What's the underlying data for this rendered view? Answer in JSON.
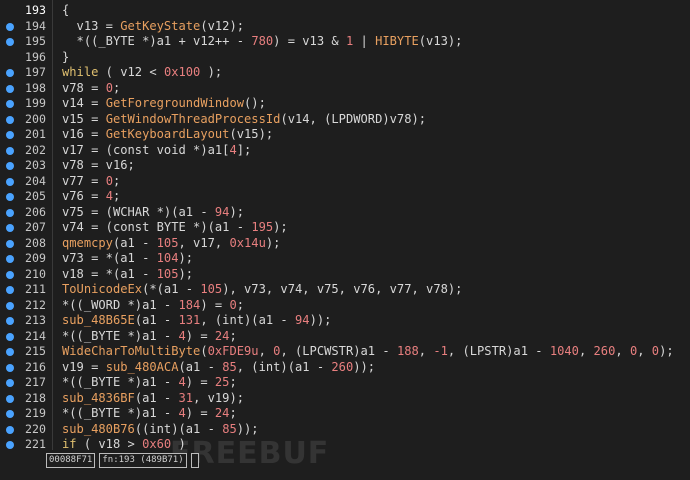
{
  "lines": [
    {
      "number": "193",
      "breakpoint": false,
      "current": true,
      "segments": [
        {
          "t": "{",
          "c": "plain"
        }
      ]
    },
    {
      "number": "194",
      "breakpoint": true,
      "segments": [
        {
          "t": "  v13 = ",
          "c": "plain"
        },
        {
          "t": "GetKeyState",
          "c": "fn"
        },
        {
          "t": "(v12);",
          "c": "plain"
        }
      ]
    },
    {
      "number": "195",
      "breakpoint": true,
      "segments": [
        {
          "t": "  *((_BYTE *)a1 + v12++ - ",
          "c": "plain"
        },
        {
          "t": "780",
          "c": "num"
        },
        {
          "t": ") = v13 & ",
          "c": "plain"
        },
        {
          "t": "1",
          "c": "num"
        },
        {
          "t": " | ",
          "c": "plain"
        },
        {
          "t": "HIBYTE",
          "c": "fn"
        },
        {
          "t": "(v13);",
          "c": "plain"
        }
      ]
    },
    {
      "number": "196",
      "breakpoint": false,
      "segments": [
        {
          "t": "}",
          "c": "plain"
        }
      ]
    },
    {
      "number": "197",
      "breakpoint": true,
      "segments": [
        {
          "t": "while",
          "c": "kw"
        },
        {
          "t": " ( v12 < ",
          "c": "plain"
        },
        {
          "t": "0x100",
          "c": "num"
        },
        {
          "t": " );",
          "c": "plain"
        }
      ]
    },
    {
      "number": "198",
      "breakpoint": true,
      "segments": [
        {
          "t": "v78 = ",
          "c": "plain"
        },
        {
          "t": "0",
          "c": "num"
        },
        {
          "t": ";",
          "c": "plain"
        }
      ]
    },
    {
      "number": "199",
      "breakpoint": true,
      "segments": [
        {
          "t": "v14 = ",
          "c": "plain"
        },
        {
          "t": "GetForegroundWindow",
          "c": "fn"
        },
        {
          "t": "();",
          "c": "plain"
        }
      ]
    },
    {
      "number": "200",
      "breakpoint": true,
      "segments": [
        {
          "t": "v15 = ",
          "c": "plain"
        },
        {
          "t": "GetWindowThreadProcessId",
          "c": "fn"
        },
        {
          "t": "(v14, (LPDWORD)v78);",
          "c": "plain"
        }
      ]
    },
    {
      "number": "201",
      "breakpoint": true,
      "segments": [
        {
          "t": "v16 = ",
          "c": "plain"
        },
        {
          "t": "GetKeyboardLayout",
          "c": "fn"
        },
        {
          "t": "(v15);",
          "c": "plain"
        }
      ]
    },
    {
      "number": "202",
      "breakpoint": true,
      "segments": [
        {
          "t": "v17 = (const void *)a1[",
          "c": "plain"
        },
        {
          "t": "4",
          "c": "num"
        },
        {
          "t": "];",
          "c": "plain"
        }
      ]
    },
    {
      "number": "203",
      "breakpoint": true,
      "segments": [
        {
          "t": "v78 = v16;",
          "c": "plain"
        }
      ]
    },
    {
      "number": "204",
      "breakpoint": true,
      "segments": [
        {
          "t": "v77 = ",
          "c": "plain"
        },
        {
          "t": "0",
          "c": "num"
        },
        {
          "t": ";",
          "c": "plain"
        }
      ]
    },
    {
      "number": "205",
      "breakpoint": true,
      "segments": [
        {
          "t": "v76 = ",
          "c": "plain"
        },
        {
          "t": "4",
          "c": "num"
        },
        {
          "t": ";",
          "c": "plain"
        }
      ]
    },
    {
      "number": "206",
      "breakpoint": true,
      "segments": [
        {
          "t": "v75 = (WCHAR *)(a1 - ",
          "c": "plain"
        },
        {
          "t": "94",
          "c": "num"
        },
        {
          "t": ");",
          "c": "plain"
        }
      ]
    },
    {
      "number": "207",
      "breakpoint": true,
      "segments": [
        {
          "t": "v74 = (const BYTE *)(a1 - ",
          "c": "plain"
        },
        {
          "t": "195",
          "c": "num"
        },
        {
          "t": ");",
          "c": "plain"
        }
      ]
    },
    {
      "number": "208",
      "breakpoint": true,
      "segments": [
        {
          "t": "qmemcpy",
          "c": "fn"
        },
        {
          "t": "(a1 - ",
          "c": "plain"
        },
        {
          "t": "105",
          "c": "num"
        },
        {
          "t": ", v17, ",
          "c": "plain"
        },
        {
          "t": "0x14u",
          "c": "num"
        },
        {
          "t": ");",
          "c": "plain"
        }
      ]
    },
    {
      "number": "209",
      "breakpoint": true,
      "segments": [
        {
          "t": "v73 = *(a1 - ",
          "c": "plain"
        },
        {
          "t": "104",
          "c": "num"
        },
        {
          "t": ");",
          "c": "plain"
        }
      ]
    },
    {
      "number": "210",
      "breakpoint": true,
      "segments": [
        {
          "t": "v18 = *(a1 - ",
          "c": "plain"
        },
        {
          "t": "105",
          "c": "num"
        },
        {
          "t": ");",
          "c": "plain"
        }
      ]
    },
    {
      "number": "211",
      "breakpoint": true,
      "segments": [
        {
          "t": "ToUnicodeEx",
          "c": "fn"
        },
        {
          "t": "(*(a1 - ",
          "c": "plain"
        },
        {
          "t": "105",
          "c": "num"
        },
        {
          "t": "), v73, v74, v75, v76, v77, v78);",
          "c": "plain"
        }
      ]
    },
    {
      "number": "212",
      "breakpoint": true,
      "segments": [
        {
          "t": "*((_WORD *)a1 - ",
          "c": "plain"
        },
        {
          "t": "184",
          "c": "num"
        },
        {
          "t": ") = ",
          "c": "plain"
        },
        {
          "t": "0",
          "c": "num"
        },
        {
          "t": ";",
          "c": "plain"
        }
      ]
    },
    {
      "number": "213",
      "breakpoint": true,
      "segments": [
        {
          "t": "sub_48B65E",
          "c": "fn"
        },
        {
          "t": "(a1 - ",
          "c": "plain"
        },
        {
          "t": "131",
          "c": "num"
        },
        {
          "t": ", (int)(a1 - ",
          "c": "plain"
        },
        {
          "t": "94",
          "c": "num"
        },
        {
          "t": "));",
          "c": "plain"
        }
      ]
    },
    {
      "number": "214",
      "breakpoint": true,
      "segments": [
        {
          "t": "*((_BYTE *)a1 - ",
          "c": "plain"
        },
        {
          "t": "4",
          "c": "num"
        },
        {
          "t": ") = ",
          "c": "plain"
        },
        {
          "t": "24",
          "c": "num"
        },
        {
          "t": ";",
          "c": "plain"
        }
      ]
    },
    {
      "number": "215",
      "breakpoint": true,
      "segments": [
        {
          "t": "WideCharToMultiByte",
          "c": "fn"
        },
        {
          "t": "(",
          "c": "plain"
        },
        {
          "t": "0xFDE9u",
          "c": "num"
        },
        {
          "t": ", ",
          "c": "plain"
        },
        {
          "t": "0",
          "c": "num"
        },
        {
          "t": ", (LPCWSTR)a1 - ",
          "c": "plain"
        },
        {
          "t": "188",
          "c": "num"
        },
        {
          "t": ", ",
          "c": "plain"
        },
        {
          "t": "-1",
          "c": "num"
        },
        {
          "t": ", (LPSTR)a1 - ",
          "c": "plain"
        },
        {
          "t": "1040",
          "c": "num"
        },
        {
          "t": ", ",
          "c": "plain"
        },
        {
          "t": "260",
          "c": "num"
        },
        {
          "t": ", ",
          "c": "plain"
        },
        {
          "t": "0",
          "c": "num"
        },
        {
          "t": ", ",
          "c": "plain"
        },
        {
          "t": "0",
          "c": "num"
        },
        {
          "t": ");",
          "c": "plain"
        }
      ]
    },
    {
      "number": "216",
      "breakpoint": true,
      "segments": [
        {
          "t": "v19 = ",
          "c": "plain"
        },
        {
          "t": "sub_480ACA",
          "c": "fn"
        },
        {
          "t": "(a1 - ",
          "c": "plain"
        },
        {
          "t": "85",
          "c": "num"
        },
        {
          "t": ", (int)(a1 - ",
          "c": "plain"
        },
        {
          "t": "260",
          "c": "num"
        },
        {
          "t": "));",
          "c": "plain"
        }
      ]
    },
    {
      "number": "217",
      "breakpoint": true,
      "segments": [
        {
          "t": "*((_BYTE *)a1 - ",
          "c": "plain"
        },
        {
          "t": "4",
          "c": "num"
        },
        {
          "t": ") = ",
          "c": "plain"
        },
        {
          "t": "25",
          "c": "num"
        },
        {
          "t": ";",
          "c": "plain"
        }
      ]
    },
    {
      "number": "218",
      "breakpoint": true,
      "segments": [
        {
          "t": "sub_4836BF",
          "c": "fn"
        },
        {
          "t": "(a1 - ",
          "c": "plain"
        },
        {
          "t": "31",
          "c": "num"
        },
        {
          "t": ", v19);",
          "c": "plain"
        }
      ]
    },
    {
      "number": "219",
      "breakpoint": true,
      "segments": [
        {
          "t": "*((_BYTE *)a1 - ",
          "c": "plain"
        },
        {
          "t": "4",
          "c": "num"
        },
        {
          "t": ") = ",
          "c": "plain"
        },
        {
          "t": "24",
          "c": "num"
        },
        {
          "t": ";",
          "c": "plain"
        }
      ]
    },
    {
      "number": "220",
      "breakpoint": true,
      "segments": [
        {
          "t": "sub_480B76",
          "c": "fn"
        },
        {
          "t": "((int)(a1 - ",
          "c": "plain"
        },
        {
          "t": "85",
          "c": "num"
        },
        {
          "t": "));",
          "c": "plain"
        }
      ]
    },
    {
      "number": "221",
      "breakpoint": true,
      "segments": [
        {
          "t": "if",
          "c": "kw"
        },
        {
          "t": " ( v18 > ",
          "c": "plain"
        },
        {
          "t": "0x60",
          "c": "num"
        },
        {
          "t": " )",
          "c": "plain"
        }
      ]
    }
  ],
  "status": {
    "address": "00088F71",
    "location": "fn:193 (489B71)"
  },
  "watermark": "FREEBUF",
  "colors": {
    "background": "#1e1e1e",
    "breakpoint": "#4aa3ff",
    "function": "#e8a060",
    "number": "#e87f7f",
    "keyword": "#e0c070",
    "text": "#d8d8d8"
  }
}
